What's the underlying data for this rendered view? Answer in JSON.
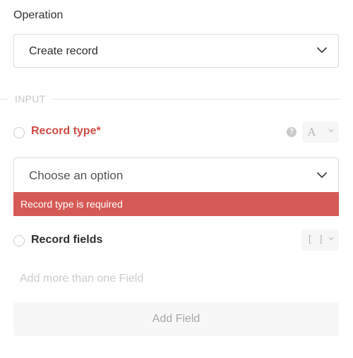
{
  "operation": {
    "label": "Operation",
    "selected": "Create record"
  },
  "section": {
    "title": "INPUT"
  },
  "record_type": {
    "label": "Record type*",
    "type_badge": "A",
    "placeholder": "Choose an option",
    "error": "Record type is required"
  },
  "record_fields": {
    "label": "Record fields",
    "type_badge": "[ ]",
    "empty_hint": "Add more than one Field",
    "add_button": "Add Field"
  },
  "colors": {
    "error": "#d55a56",
    "error_label": "#cf4b46"
  }
}
